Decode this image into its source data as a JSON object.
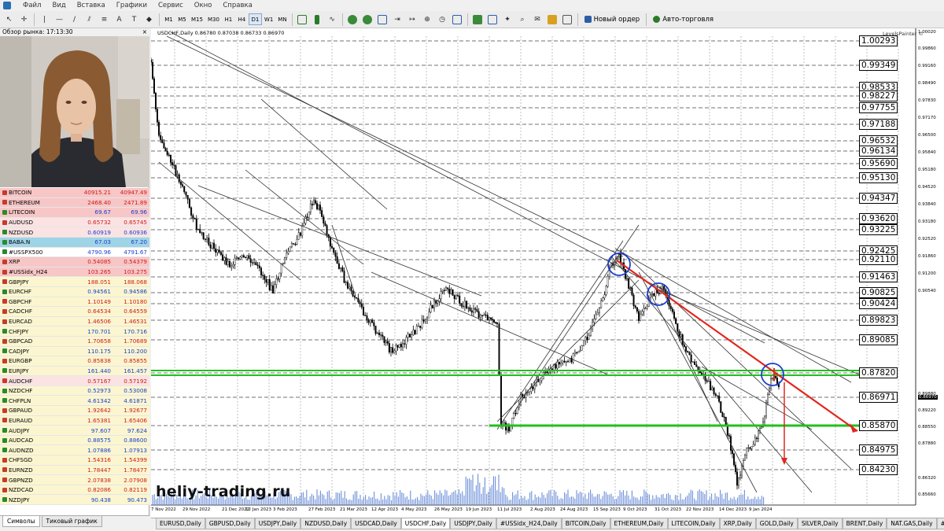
{
  "menu": [
    "Файл",
    "Вид",
    "Вставка",
    "Графики",
    "Сервис",
    "Окно",
    "Справка"
  ],
  "toolbar": {
    "timeframes": [
      "M1",
      "M5",
      "M15",
      "M30",
      "H1",
      "H4",
      "D1",
      "W1",
      "MN"
    ],
    "active_timeframe": "D1",
    "new_order_label": "Новый ордер",
    "auto_trade_label": "Авто-торговля"
  },
  "market_watch": {
    "title": "Обзор рынка: 17:13:30",
    "rows": [
      {
        "symbol": "BITCOIN",
        "bid": "40915.21",
        "ask": "40947.49",
        "highlight": "#f7c6c6",
        "dir": "dn"
      },
      {
        "symbol": "ETHEREUM",
        "bid": "2468.40",
        "ask": "2471.89",
        "highlight": "#f7c6c6",
        "dir": "dn"
      },
      {
        "symbol": "LITECOIN",
        "bid": "69.67",
        "ask": "69.96",
        "highlight": "#f7c6c6",
        "dir": "up"
      },
      {
        "symbol": "AUDUSD",
        "bid": "0.65732",
        "ask": "0.65745",
        "highlight": "#fbe3e3",
        "dir": "dn"
      },
      {
        "symbol": "NZDUSD",
        "bid": "0.60919",
        "ask": "0.60936",
        "highlight": "#fbe3e3",
        "dir": "up"
      },
      {
        "symbol": "BABA.N",
        "bid": "67.03",
        "ask": "67.20",
        "highlight": "#9fd3e6",
        "dir": "up"
      },
      {
        "symbol": "#USSPX500",
        "bid": "4790.96",
        "ask": "4791.67",
        "highlight": "#ffffff",
        "dir": "up"
      },
      {
        "symbol": "XRP",
        "bid": "0.54085",
        "ask": "0.54379",
        "highlight": "#f7c6c6",
        "dir": "dn"
      },
      {
        "symbol": "#USSidx_H24",
        "bid": "103.265",
        "ask": "103.275",
        "highlight": "#f7c6c6",
        "dir": "dn"
      },
      {
        "symbol": "GBPJPY",
        "bid": "188.051",
        "ask": "188.068",
        "highlight": "#fbf6cf",
        "dir": "dn"
      },
      {
        "symbol": "EURCHF",
        "bid": "0.94561",
        "ask": "0.94586",
        "highlight": "#fbf6cf",
        "dir": "up"
      },
      {
        "symbol": "GBPCHF",
        "bid": "1.10149",
        "ask": "1.10180",
        "highlight": "#fbf6cf",
        "dir": "dn"
      },
      {
        "symbol": "CADCHF",
        "bid": "0.64534",
        "ask": "0.64559",
        "highlight": "#fbf6cf",
        "dir": "dn"
      },
      {
        "symbol": "EURCAD",
        "bid": "1.46506",
        "ask": "1.46531",
        "highlight": "#fbf6cf",
        "dir": "dn"
      },
      {
        "symbol": "CHFJPY",
        "bid": "170.701",
        "ask": "170.716",
        "highlight": "#fbf6cf",
        "dir": "up"
      },
      {
        "symbol": "GBPCAD",
        "bid": "1.70658",
        "ask": "1.70689",
        "highlight": "#fbf6cf",
        "dir": "dn"
      },
      {
        "symbol": "CADJPY",
        "bid": "110.175",
        "ask": "110.200",
        "highlight": "#fbf6cf",
        "dir": "up"
      },
      {
        "symbol": "EURGBP",
        "bid": "0.85838",
        "ask": "0.85855",
        "highlight": "#fbf6cf",
        "dir": "dn"
      },
      {
        "symbol": "EURJPY",
        "bid": "161.440",
        "ask": "161.457",
        "highlight": "#fbf6cf",
        "dir": "up"
      },
      {
        "symbol": "AUDCHF",
        "bid": "0.57167",
        "ask": "0.57192",
        "highlight": "#fbe3e3",
        "dir": "dn"
      },
      {
        "symbol": "NZDCHF",
        "bid": "0.52973",
        "ask": "0.53008",
        "highlight": "#fbf6cf",
        "dir": "up"
      },
      {
        "symbol": "CHFPLN",
        "bid": "4.61342",
        "ask": "4.61871",
        "highlight": "#fbf6cf",
        "dir": "up"
      },
      {
        "symbol": "GBPAUD",
        "bid": "1.92642",
        "ask": "1.92677",
        "highlight": "#fbf6cf",
        "dir": "dn"
      },
      {
        "symbol": "EURAUD",
        "bid": "1.65381",
        "ask": "1.65406",
        "highlight": "#fbf6cf",
        "dir": "dn"
      },
      {
        "symbol": "AUDJPY",
        "bid": "97.607",
        "ask": "97.624",
        "highlight": "#fbf6cf",
        "dir": "up"
      },
      {
        "symbol": "AUDCAD",
        "bid": "0.88575",
        "ask": "0.88600",
        "highlight": "#fbf6cf",
        "dir": "up"
      },
      {
        "symbol": "AUDNZD",
        "bid": "1.07886",
        "ask": "1.07913",
        "highlight": "#fbf6cf",
        "dir": "up"
      },
      {
        "symbol": "CHFSGD",
        "bid": "1.54316",
        "ask": "1.54399",
        "highlight": "#fbf6cf",
        "dir": "dn"
      },
      {
        "symbol": "EURNZD",
        "bid": "1.78447",
        "ask": "1.78477",
        "highlight": "#fbf6cf",
        "dir": "dn"
      },
      {
        "symbol": "GBPNZD",
        "bid": "2.07838",
        "ask": "2.07908",
        "highlight": "#fbf6cf",
        "dir": "dn"
      },
      {
        "symbol": "NZDCAD",
        "bid": "0.82086",
        "ask": "0.82119",
        "highlight": "#fbf6cf",
        "dir": "dn"
      },
      {
        "symbol": "NZDJPY",
        "bid": "90.438",
        "ask": "90.473",
        "highlight": "#fbf6cf",
        "dir": "up"
      }
    ],
    "tabs": [
      "Символы",
      "Тиковый график"
    ],
    "active_tab": "Символы"
  },
  "chart": {
    "title": "USDCHF,Daily  0.86780 0.87038 0.86733 0.86970",
    "indicator": "LevelsPainter ©",
    "watermark": "heliy-trading.ru",
    "current_price": "0.86970",
    "levels": [
      "1.00293",
      "0.99349",
      "0.98533",
      "0.98227",
      "0.97755",
      "0.97188",
      "0.96532",
      "0.96134",
      "0.95690",
      "0.95130",
      "0.94347",
      "0.93620",
      "0.93225",
      "0.92425",
      "0.92110",
      "0.91463",
      "0.90825",
      "0.90424",
      "0.89823",
      "0.89085",
      "0.87820",
      "0.86971",
      "0.85870",
      "0.84975",
      "0.84230"
    ],
    "price_axis": [
      "1.00020",
      "0.99860",
      "0.99160",
      "0.98490",
      "0.97830",
      "0.97170",
      "0.96500",
      "0.95840",
      "0.95180",
      "0.94520",
      "0.93840",
      "0.93180",
      "0.92520",
      "0.91860",
      "0.91200",
      "0.90540",
      "0.89880",
      "0.89220",
      "0.88550",
      "0.87880",
      "0.86970",
      "0.86320",
      "0.85660",
      "0.85000",
      "0.84330",
      "0.83620",
      "0.82960"
    ],
    "date_axis": [
      "7 Nov 2022",
      "29 Nov 2022",
      "21 Dec 2022",
      "12 Jan 2023",
      "3 Feb 2023",
      "27 Feb 2023",
      "21 Mar 2023",
      "12 Apr 2023",
      "4 May 2023",
      "26 May 2023",
      "19 Jun 2023",
      "11 Jul 2023",
      "2 Aug 2023",
      "24 Aug 2023",
      "15 Sep 2023",
      "9 Oct 2023",
      "31 Oct 2023",
      "22 Nov 2023",
      "14 Dec 2023",
      "9 Jan 2024"
    ],
    "colors": {
      "level_green": "#22c01e",
      "trend_red": "#e0281e",
      "circle_blue": "#1a3fd0",
      "volume": "#6c8fd8"
    }
  },
  "bottom_tabs": [
    "EURUSD,Daily",
    "GBPUSD,Daily",
    "USDJPY,Daily",
    "NZDUSD,Daily",
    "USDCAD,Daily",
    "USDCHF,Daily",
    "USDJPY,Daily",
    "#USSidx_H24,Daily",
    "BITCOIN,Daily",
    "ETHEREUM,Daily",
    "LITECOIN,Daily",
    "XRP,Daily",
    "GOLD,Daily",
    "SILVER,Daily",
    "BRENT,Daily",
    "NAT.GAS,Daily",
    "#USSP"
  ],
  "active_bottom_tab": "USDCHF,Daily"
}
